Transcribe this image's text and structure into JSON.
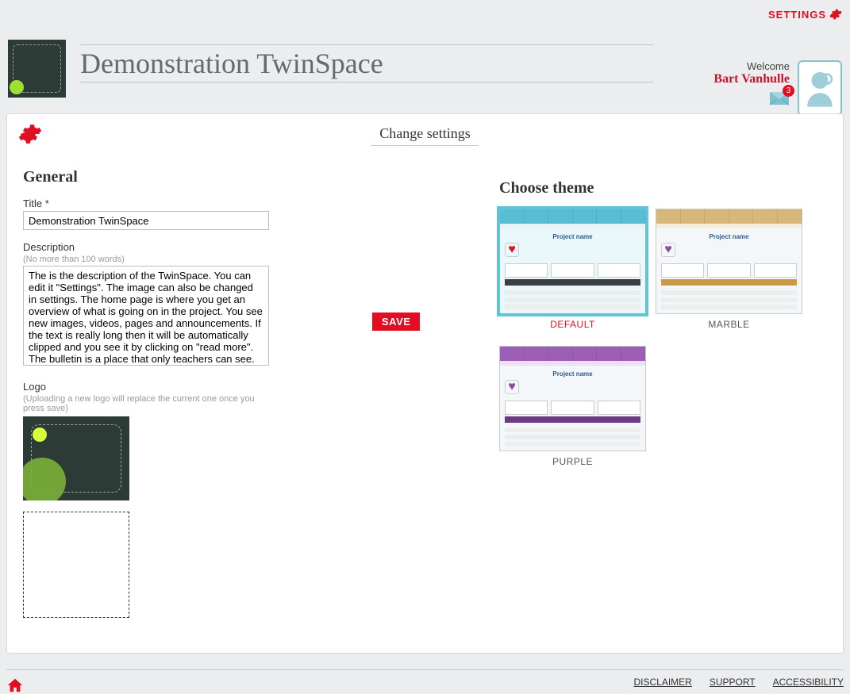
{
  "topbar": {
    "settings_label": "SETTINGS"
  },
  "header": {
    "page_title": "Demonstration TwinSpace",
    "welcome_label": "Welcome",
    "username": "Bart Vanhulle",
    "notification_count": "3"
  },
  "panel": {
    "title": "Change settings"
  },
  "general": {
    "heading": "General",
    "title_label": "Title *",
    "title_value": "Demonstration TwinSpace",
    "description_label": "Description",
    "description_hint": "(No more than 100 words)",
    "description_value": "The is the description of the TwinSpace. You can edit it \"Settings\". The image can also be changed in settings. The home page is where you get an overview of what is going on in the project. You see new images, videos, pages and announcements. If the text is really long then it will be automatically clipped and you see it by clicking on \"read more\". The bulletin is a place that only teachers can see.",
    "logo_label": "Logo",
    "logo_hint": "(Uploading a new logo will replace the current one once you press save)"
  },
  "save_label": "SAVE",
  "themes": {
    "heading": "Choose theme",
    "items": [
      {
        "label": "DEFAULT",
        "selected": true,
        "variant": "default"
      },
      {
        "label": "MARBLE",
        "selected": false,
        "variant": "marble"
      },
      {
        "label": "PURPLE",
        "selected": false,
        "variant": "purple"
      }
    ],
    "preview_text": "Project name"
  },
  "footer": {
    "links": [
      "DISCLAIMER",
      "SUPPORT",
      "ACCESSIBILITY"
    ]
  }
}
